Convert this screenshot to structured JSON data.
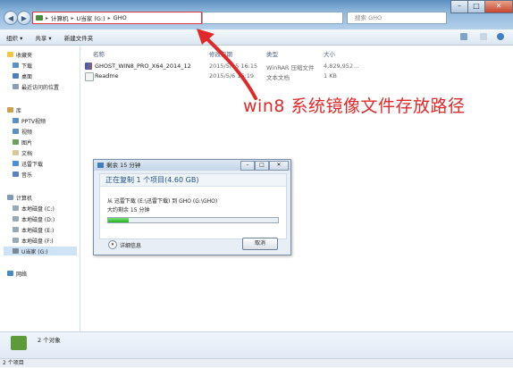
{
  "address": {
    "segments": [
      "计算机",
      "U当家 (G:)",
      "GHO"
    ]
  },
  "search": {
    "placeholder": "搜索 GHO"
  },
  "toolbar": {
    "organize": "组织 ▾",
    "share": "共享 ▾",
    "new_folder": "新建文件夹"
  },
  "sidebar": {
    "favorites": "收藏夹",
    "favorites_items": [
      "下载",
      "桌面",
      "最近访问的位置"
    ],
    "libraries": "库",
    "libraries_items": [
      "PPTV视频",
      "视频",
      "图片",
      "文档",
      "迅雷下载",
      "音乐"
    ],
    "computer": "计算机",
    "computer_items": [
      "本地磁盘 (C:)",
      "本地磁盘 (D:)",
      "本地磁盘 (E:)",
      "本地磁盘 (F:)",
      "U当家 (G:)"
    ],
    "network": "网络"
  },
  "columns": {
    "name": "名称",
    "date": "修改日期",
    "type": "类型",
    "size": "大小"
  },
  "files": [
    {
      "name": "GHOST_WIN8_PRO_X64_2014_12",
      "date": "2015/5/15 16:15",
      "type": "WinRAR 压缩文件",
      "size": "4,829,952..."
    },
    {
      "name": "Readme",
      "date": "2015/5/6 16:19",
      "type": "文本文档",
      "size": "1 KB"
    }
  ],
  "annotation": {
    "text": "win8 系统镜像文件存放路径"
  },
  "dialog": {
    "title": "剩余 15 分钟",
    "heading": "正在复制 1 个项目(4.60 GB)",
    "from_line": "从 迅雷下载 (E:\\迅雷下载) 到 GHO (G:\\GHO)",
    "remaining": "大约剩余 15 分钟",
    "progress_fraction": 0.12,
    "details_label": "详细信息",
    "cancel_label": "取消"
  },
  "details_pane": {
    "count": "2 个对象"
  },
  "status": {
    "count": "2 个项目"
  },
  "colors": {
    "annotation": "#e02828",
    "progress": "#22b318",
    "highlight_box": "#e03a3a"
  }
}
